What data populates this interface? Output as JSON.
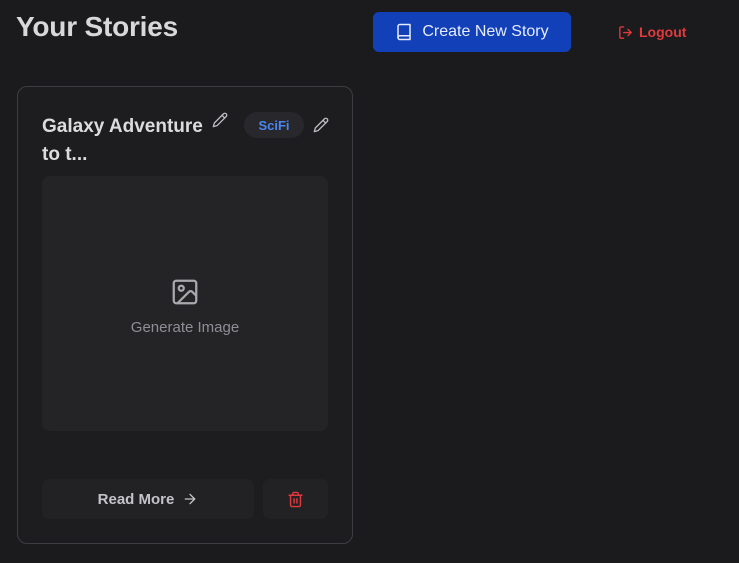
{
  "header": {
    "title": "Your Stories",
    "create_label": "Create New Story",
    "logout_label": "Logout"
  },
  "stories": [
    {
      "title": "Galaxy Adventure to t...",
      "genre": "SciFi",
      "image_placeholder": "Generate Image",
      "read_more_label": "Read More"
    }
  ],
  "colors": {
    "background": "#1b1b1d",
    "primary_button": "#1240b8",
    "logout": "#e0393e",
    "genre_badge_text": "#4a86ee",
    "delete_icon": "#e0393e"
  },
  "icons": {
    "create": "book-icon",
    "logout": "logout-icon",
    "edit": "pencil-icon",
    "image": "image-icon",
    "arrow": "arrow-right-icon",
    "delete": "trash-icon"
  }
}
